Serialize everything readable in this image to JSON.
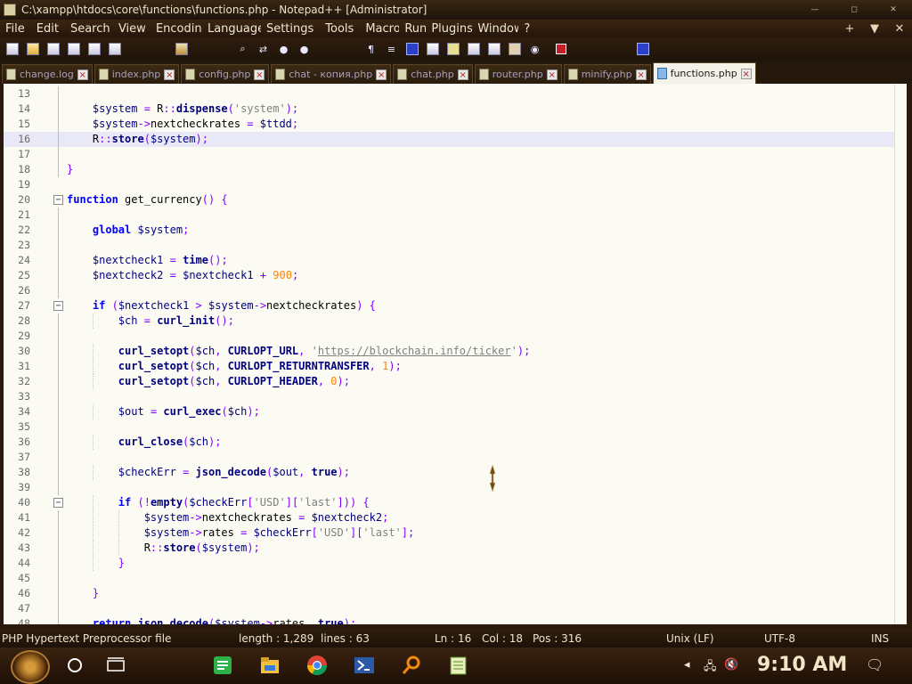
{
  "window": {
    "title": "C:\\xampp\\htdocs\\core\\functions\\functions.php - Notepad++ [Administrator]",
    "controls": [
      "—",
      "◻",
      "✕"
    ]
  },
  "menu": {
    "items": [
      "File",
      "Edit",
      "Search",
      "View",
      "Encoding",
      "Language",
      "Settings",
      "Tools",
      "Macro",
      "Run",
      "Plugins",
      "Window",
      "?"
    ],
    "right": [
      "+",
      "▼",
      "✕"
    ]
  },
  "tabs": [
    {
      "label": "change.log",
      "active": false
    },
    {
      "label": "index.php",
      "active": false
    },
    {
      "label": "config.php",
      "active": false
    },
    {
      "label": "chat - копия.php",
      "active": false
    },
    {
      "label": "chat.php",
      "active": false
    },
    {
      "label": "router.php",
      "active": false
    },
    {
      "label": "minify.php",
      "active": false
    },
    {
      "label": "functions.php",
      "active": true
    }
  ],
  "editor": {
    "lines": [
      {
        "n": "13",
        "text": ""
      },
      {
        "n": "14",
        "text": "    $system = R::dispense('system');"
      },
      {
        "n": "15",
        "text": "    $system->nextcheckrates = $ttdd;"
      },
      {
        "n": "16",
        "text": "    R::store($system);"
      },
      {
        "n": "17",
        "text": ""
      },
      {
        "n": "18",
        "text": "}"
      },
      {
        "n": "19",
        "text": ""
      },
      {
        "n": "20",
        "text": "function get_currency() {"
      },
      {
        "n": "21",
        "text": ""
      },
      {
        "n": "22",
        "text": "    global $system;"
      },
      {
        "n": "23",
        "text": ""
      },
      {
        "n": "24",
        "text": "    $nextcheck1 = time();"
      },
      {
        "n": "25",
        "text": "    $nextcheck2 = $nextcheck1 + 900;"
      },
      {
        "n": "26",
        "text": ""
      },
      {
        "n": "27",
        "text": "    if ($nextcheck1 > $system->nextcheckrates) {"
      },
      {
        "n": "28",
        "text": "        $ch = curl_init();"
      },
      {
        "n": "29",
        "text": ""
      },
      {
        "n": "30",
        "text": "        curl_setopt($ch, CURLOPT_URL, 'https://blockchain.info/ticker');"
      },
      {
        "n": "31",
        "text": "        curl_setopt($ch, CURLOPT_RETURNTRANSFER, 1);"
      },
      {
        "n": "32",
        "text": "        curl_setopt($ch, CURLOPT_HEADER, 0);"
      },
      {
        "n": "33",
        "text": ""
      },
      {
        "n": "34",
        "text": "        $out = curl_exec($ch);"
      },
      {
        "n": "35",
        "text": ""
      },
      {
        "n": "36",
        "text": "        curl_close($ch);"
      },
      {
        "n": "37",
        "text": ""
      },
      {
        "n": "38",
        "text": "        $checkErr = json_decode($out, true);"
      },
      {
        "n": "39",
        "text": ""
      },
      {
        "n": "40",
        "text": "        if (!empty($checkErr['USD']['last'])) {"
      },
      {
        "n": "41",
        "text": "            $system->nextcheckrates = $nextcheck2;"
      },
      {
        "n": "42",
        "text": "            $system->rates = $checkErr['USD']['last'];"
      },
      {
        "n": "43",
        "text": "            R::store($system);"
      },
      {
        "n": "44",
        "text": "        }"
      },
      {
        "n": "45",
        "text": ""
      },
      {
        "n": "46",
        "text": "    }"
      },
      {
        "n": "47",
        "text": ""
      },
      {
        "n": "48",
        "text": "    return json_decode($system->rates, true);"
      }
    ],
    "current_line": "16"
  },
  "status": {
    "filetype": "PHP Hypertext Preprocessor file",
    "length": "length : 1,289",
    "lines": "lines : 63",
    "ln": "Ln : 16",
    "col": "Col : 18",
    "pos": "Pos : 316",
    "eol": "Unix (LF)",
    "encoding": "UTF-8",
    "mode": "INS"
  },
  "taskbar": {
    "clock": "9:10 AM"
  },
  "colors": {
    "editor_bg": "#fcfbf3",
    "keyword": "#0000ff",
    "current_line": "#e8e8f6"
  }
}
